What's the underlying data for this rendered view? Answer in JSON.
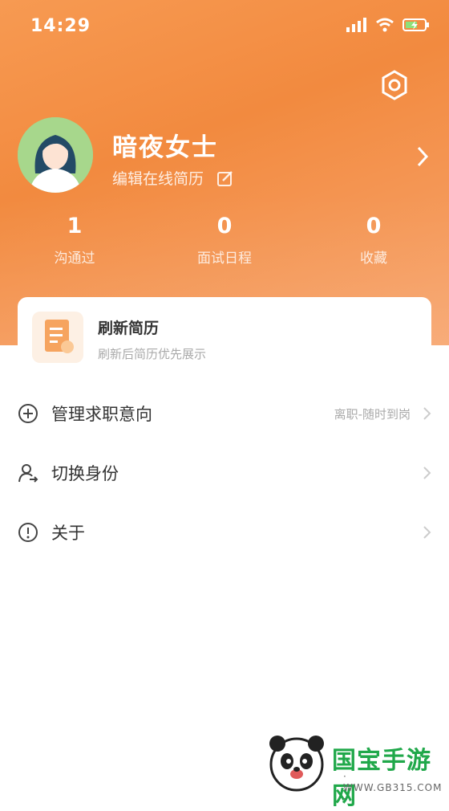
{
  "status_bar": {
    "time": "14:29"
  },
  "profile": {
    "name": "暗夜女士",
    "edit_label": "编辑在线简历"
  },
  "stats": [
    {
      "value": "1",
      "label": "沟通过"
    },
    {
      "value": "0",
      "label": "面试日程"
    },
    {
      "value": "0",
      "label": "收藏"
    }
  ],
  "refresh_card": {
    "title": "刷新简历",
    "subtitle": "刷新后简历优先展示"
  },
  "menu": [
    {
      "label": "管理求职意向",
      "value": "离职-随时到岗",
      "icon": "plus-circle-icon"
    },
    {
      "label": "切换身份",
      "value": "",
      "icon": "person-switch-icon"
    },
    {
      "label": "关于",
      "value": "",
      "icon": "info-circle-icon"
    }
  ],
  "watermark": {
    "brand": "国宝手游网",
    "url": "· WWW.GB315.COM ·"
  },
  "colors": {
    "header": "#f28a3f",
    "brand_green": "#20a84a"
  }
}
